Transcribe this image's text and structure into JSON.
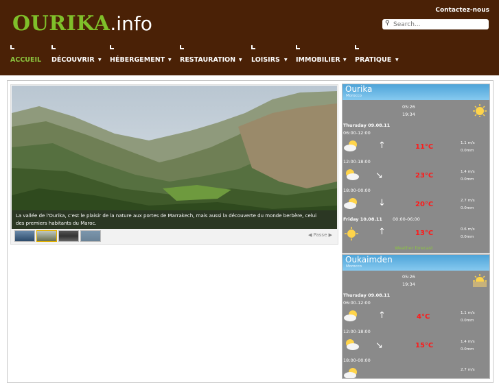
{
  "site": {
    "brand": "OURIKA",
    "tld": ".info",
    "contact_label": "Contactez-nous",
    "search_placeholder": "Search..."
  },
  "nav": {
    "items": [
      {
        "label": "ACCUEIL",
        "active": true
      },
      {
        "label": "DÉCOUVRIR"
      },
      {
        "label": "HÉBERGEMENT"
      },
      {
        "label": "RESTAURATION"
      },
      {
        "label": "LOISIRS"
      },
      {
        "label": "IMMOBILIER"
      },
      {
        "label": "PRATIQUE"
      }
    ]
  },
  "slider": {
    "caption": "La vallée de l'Ourika, c'est le plaisir de la nature aux portes de Marrakech, mais aussi la découverte du monde berbère, celui des premiers habitants du Maroc.",
    "pager_label": "Passe"
  },
  "weather": [
    {
      "location": "Ourika",
      "country": "Morocco",
      "sunrise": "05:26",
      "sunset": "19:34",
      "rows": [
        {
          "day": "Thursday 09.08.11",
          "period": "06:00-12:00",
          "temp": "11°C",
          "wind": "1.1 m/s",
          "precip": "0.0mm"
        },
        {
          "period": "12:00-18:00",
          "temp": "23°C",
          "wind": "1.4 m/s",
          "precip": "0.0mm"
        },
        {
          "period": "18:00-00:00",
          "temp": "20°C",
          "wind": "2.7 m/s",
          "precip": "0.0mm"
        },
        {
          "day": "Friday 10.08.11",
          "period": "00:00-06:00",
          "temp": "13°C",
          "wind": "0.6 m/s",
          "precip": "0.0mm"
        }
      ],
      "link": "Weather forecast"
    },
    {
      "location": "Oukaimden",
      "country": "Morocco",
      "sunrise": "05:26",
      "sunset": "19:34",
      "rows": [
        {
          "day": "Thursday 09.08.11",
          "period": "06:00-12:00",
          "temp": "4°C",
          "wind": "1.1 m/s",
          "precip": "0.0mm"
        },
        {
          "period": "12:00-18:00",
          "temp": "15°C",
          "wind": "1.4 m/s",
          "precip": "0.0mm"
        },
        {
          "period": "18:00-00:00",
          "wind": "2.7 m/s"
        }
      ]
    }
  ]
}
